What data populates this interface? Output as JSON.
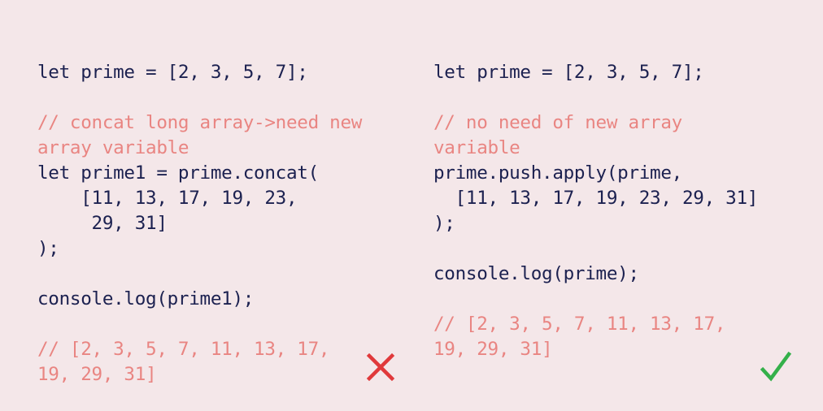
{
  "left": {
    "lines": [
      {
        "text": "let prime = [2, 3, 5, 7];",
        "kind": "code"
      },
      {
        "text": "",
        "kind": "blank"
      },
      {
        "text": "// concat long array->need new",
        "kind": "comment"
      },
      {
        "text": "array variable",
        "kind": "comment"
      },
      {
        "text": "let prime1 = prime.concat(",
        "kind": "code"
      },
      {
        "text": "    [11, 13, 17, 19, 23,",
        "kind": "code"
      },
      {
        "text": "     29, 31]",
        "kind": "code"
      },
      {
        "text": ");",
        "kind": "code"
      },
      {
        "text": "",
        "kind": "blank"
      },
      {
        "text": "console.log(prime1);",
        "kind": "code"
      },
      {
        "text": "",
        "kind": "blank"
      },
      {
        "text": "// [2, 3, 5, 7, 11, 13, 17,",
        "kind": "comment"
      },
      {
        "text": "19, 29, 31]",
        "kind": "comment"
      }
    ],
    "verdict_icon": "cross-icon",
    "verdict_color": "#e0393b"
  },
  "right": {
    "lines": [
      {
        "text": "let prime = [2, 3, 5, 7];",
        "kind": "code"
      },
      {
        "text": "",
        "kind": "blank"
      },
      {
        "text": "// no need of new array",
        "kind": "comment"
      },
      {
        "text": "variable",
        "kind": "comment"
      },
      {
        "text": "prime.push.apply(prime,",
        "kind": "code"
      },
      {
        "text": "  [11, 13, 17, 19, 23, 29, 31]",
        "kind": "code"
      },
      {
        "text": ");",
        "kind": "code"
      },
      {
        "text": "",
        "kind": "blank"
      },
      {
        "text": "console.log(prime);",
        "kind": "code"
      },
      {
        "text": "",
        "kind": "blank"
      },
      {
        "text": "// [2, 3, 5, 7, 11, 13, 17,",
        "kind": "comment"
      },
      {
        "text": "19, 29, 31]",
        "kind": "comment"
      }
    ],
    "verdict_icon": "checkmark-icon",
    "verdict_color": "#34b04a"
  },
  "colors": {
    "background": "#f4e7e9",
    "code": "#1c2150",
    "comment": "#e98582"
  }
}
